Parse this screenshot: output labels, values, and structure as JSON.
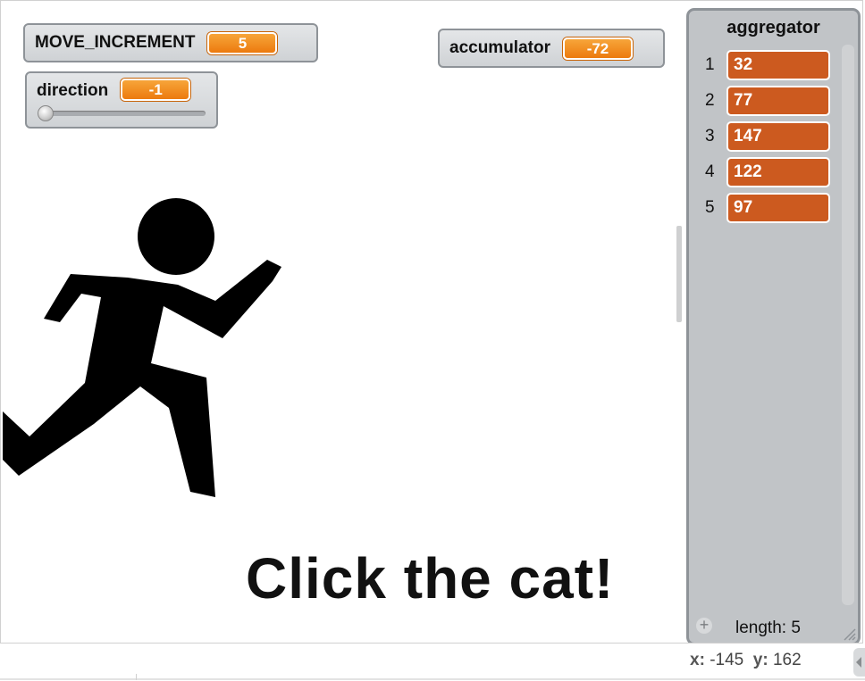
{
  "monitors": {
    "move_increment": {
      "label": "MOVE_INCREMENT",
      "value": "5"
    },
    "accumulator": {
      "label": "accumulator",
      "value": "-72"
    },
    "direction": {
      "label": "direction",
      "value": "-1",
      "slider_level": 0
    }
  },
  "stage": {
    "text": "Click the cat!"
  },
  "list": {
    "title": "aggregator",
    "items": [
      {
        "index": "1",
        "value": "32"
      },
      {
        "index": "2",
        "value": "77"
      },
      {
        "index": "3",
        "value": "147"
      },
      {
        "index": "4",
        "value": "122"
      },
      {
        "index": "5",
        "value": "97"
      }
    ],
    "add_label": "+",
    "length_text": "length: 5"
  },
  "coords": {
    "x_label": "x:",
    "x_value": "-145",
    "y_label": "y:",
    "y_value": "162"
  },
  "colors": {
    "monitor_value": "#ec7a0e",
    "list_cell": "#cc5a1f",
    "monitor_bg": "#d6d9dc"
  }
}
